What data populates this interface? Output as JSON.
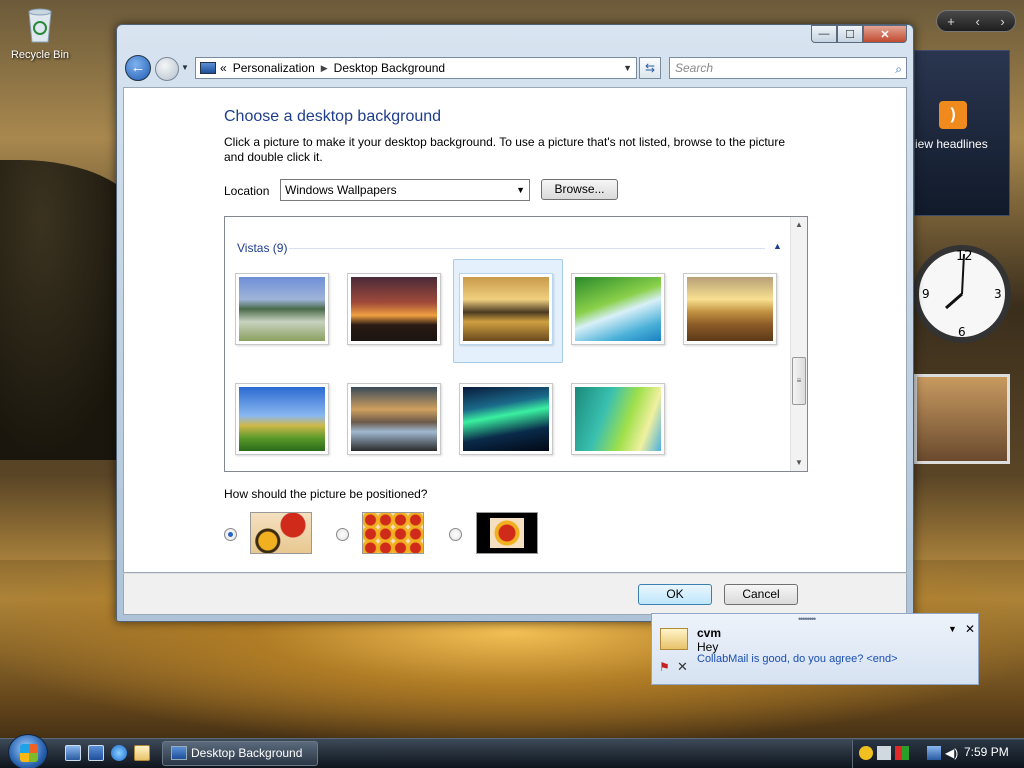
{
  "desktop": {
    "icons": [
      {
        "label": "Recycle Bin"
      }
    ]
  },
  "sidebar": {
    "controls": {
      "add": "+",
      "prev": "‹",
      "next": "›"
    },
    "feed_gadget": {
      "label": "iew headlines"
    }
  },
  "window": {
    "buttons": {
      "minimize": "—",
      "maximize": "☐",
      "close": "✕"
    },
    "address": {
      "overflow": "«",
      "crumbs": [
        "Personalization",
        "Desktop Background"
      ]
    },
    "search_placeholder": "Search",
    "title": "Choose a desktop background",
    "description": "Click a picture to make it your desktop background. To use a picture that's not listed, browse to the picture and double click it.",
    "location": {
      "label": "Location",
      "value": "Windows Wallpapers",
      "browse_label": "Browse..."
    },
    "gallery": {
      "group_label": "Vistas (9)",
      "thumbnails": [
        {
          "name": "mountains-lake",
          "selected": false
        },
        {
          "name": "dusk-horizon",
          "selected": false
        },
        {
          "name": "golden-rocks",
          "selected": true
        },
        {
          "name": "palm-frond",
          "selected": false
        },
        {
          "name": "wheat-field",
          "selected": false
        },
        {
          "name": "green-hills",
          "selected": false
        },
        {
          "name": "rock-pools",
          "selected": false
        },
        {
          "name": "aurora",
          "selected": false
        },
        {
          "name": "vista-aurora",
          "selected": false
        }
      ]
    },
    "position": {
      "label": "How should the picture be positioned?",
      "options": [
        {
          "name": "fit-to-screen",
          "selected": true
        },
        {
          "name": "tile",
          "selected": false
        },
        {
          "name": "center",
          "selected": false
        }
      ]
    },
    "ok_label": "OK",
    "cancel_label": "Cancel"
  },
  "notification": {
    "sender": "cvm",
    "subject": "Hey",
    "body": "CollabMail is good, do you agree? <end>"
  },
  "taskbar": {
    "task_label": "Desktop Background",
    "clock": "7:59 PM"
  },
  "colors": {
    "title_blue": "#1e3d8c",
    "selection": "#e4f0fb",
    "link_blue": "#1a4fb0"
  }
}
